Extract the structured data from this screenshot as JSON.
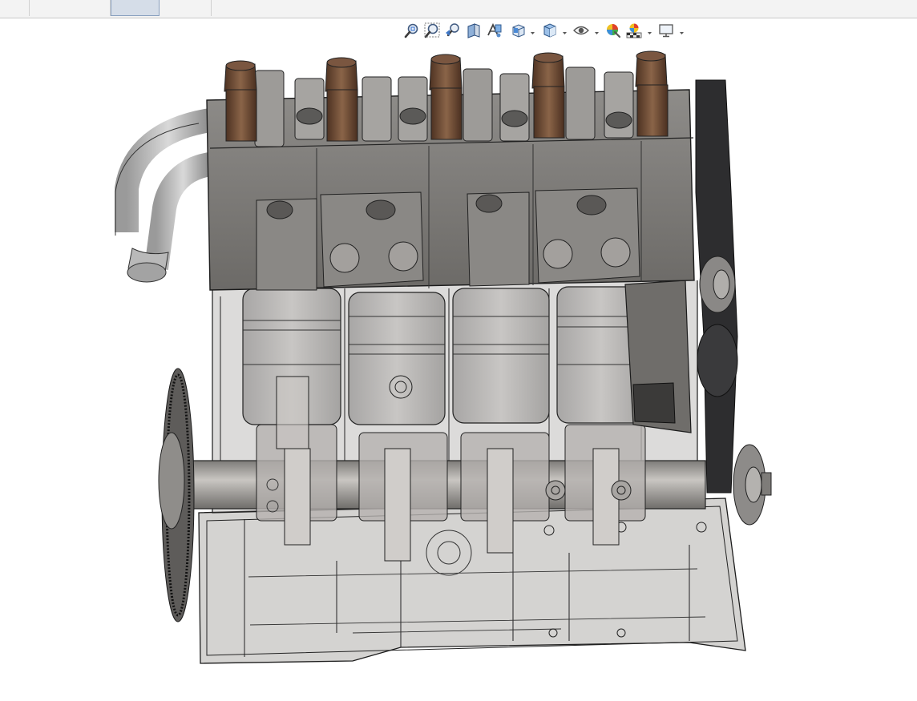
{
  "window": {
    "tabs": [
      {
        "label": "",
        "active": false
      },
      {
        "label": "",
        "active": false
      },
      {
        "label": "",
        "active": true
      },
      {
        "label": "",
        "active": false
      }
    ]
  },
  "view_toolbar": {
    "items": [
      {
        "icon": "zoom-to-fit-icon"
      },
      {
        "icon": "zoom-to-area-icon"
      },
      {
        "icon": "previous-view-icon"
      },
      {
        "icon": "section-view-icon"
      },
      {
        "icon": "dynamic-annotation-icon"
      },
      {
        "icon": "view-orientation-icon",
        "dropdown": true
      },
      {
        "icon": "display-style-icon",
        "dropdown": true
      },
      {
        "icon": "hide-show-items-icon",
        "dropdown": true
      },
      {
        "icon": "edit-appearance-icon"
      },
      {
        "icon": "apply-scene-icon",
        "dropdown": true
      },
      {
        "icon": "view-settings-icon",
        "dropdown": true
      }
    ]
  },
  "model": {
    "name": "",
    "cylinders": 4,
    "colors": {
      "head": "#7a7875",
      "injector": "#6b4a36",
      "belt": "#2d2d2f",
      "block_transparent": "#8c8a88",
      "edge": "#1c1c1c",
      "piston": "#b9b6b3"
    }
  }
}
